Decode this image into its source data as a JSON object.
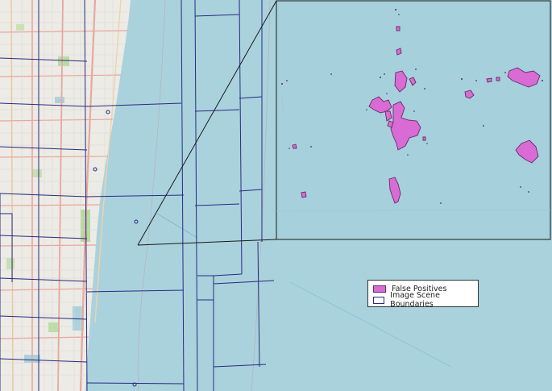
{
  "map": {
    "colors": {
      "water": "#a9d2dd",
      "inset_water": "#a5d0dc",
      "land": "#ecebe5",
      "roads_major": "#e7a7a0",
      "scene_boundary": "#2a2a80",
      "false_positive": "#d96bd4",
      "false_positive_edge": "#6a2a66"
    },
    "legend": {
      "items": [
        {
          "label": "False Positives",
          "swatch": "false-positive"
        },
        {
          "label": "Image Scene Boundaries",
          "swatch": "scene-boundary"
        }
      ]
    }
  }
}
